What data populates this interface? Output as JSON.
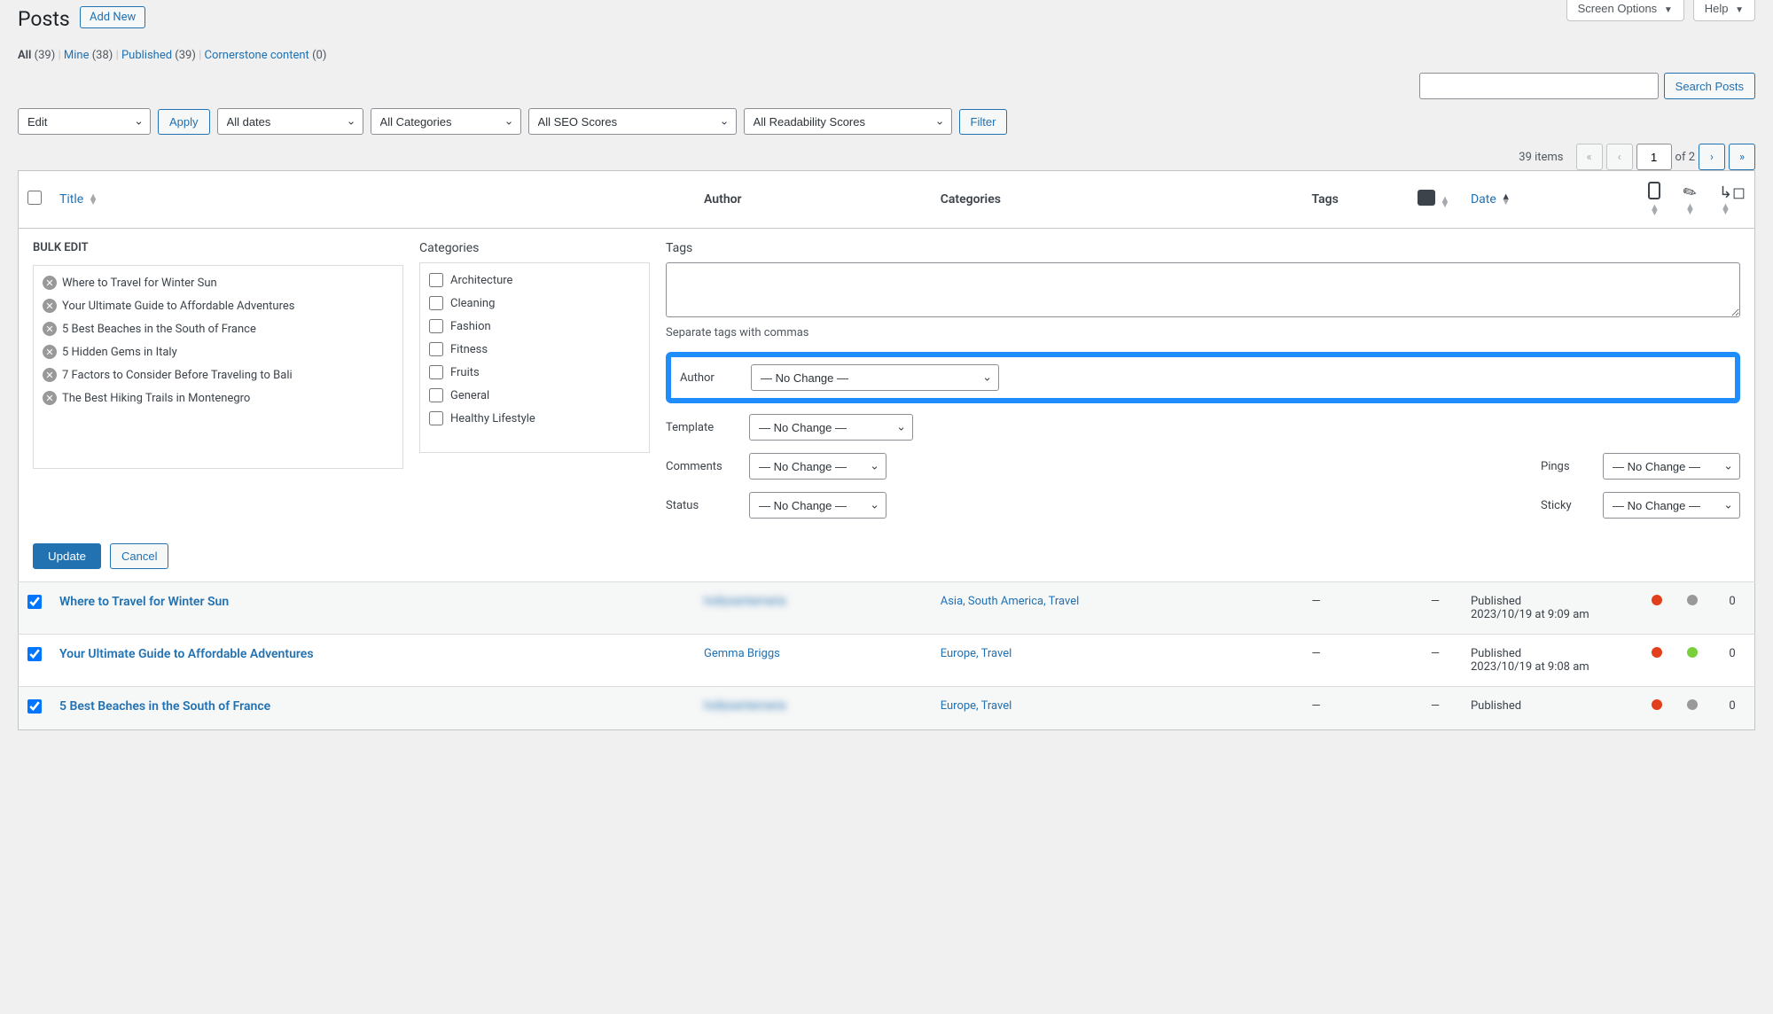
{
  "screenOptions": "Screen Options",
  "help": "Help",
  "page": {
    "title": "Posts",
    "addNew": "Add New"
  },
  "filters": {
    "all": "All",
    "allCount": "(39)",
    "mine": "Mine",
    "mineCount": "(38)",
    "published": "Published",
    "publishedCount": "(39)",
    "cornerstone": "Cornerstone content",
    "cornerstoneCount": "(0)"
  },
  "searchButton": "Search Posts",
  "bulk": {
    "action": "Edit",
    "apply": "Apply",
    "dates": "All dates",
    "categories": "All Categories",
    "seo": "All SEO Scores",
    "readability": "All Readability Scores",
    "filter": "Filter"
  },
  "pagination": {
    "items": "39 items",
    "current": "1",
    "total": "of 2"
  },
  "columns": {
    "title": "Title",
    "author": "Author",
    "categories": "Categories",
    "tags": "Tags",
    "date": "Date"
  },
  "bulkEdit": {
    "heading": "BULK EDIT",
    "categoriesLabel": "Categories",
    "tagsLabel": "Tags",
    "posts": [
      "Where to Travel for Winter Sun",
      "Your Ultimate Guide to Affordable Adventures",
      "5 Best Beaches in the South of France",
      "5 Hidden Gems in Italy",
      "7 Factors to Consider Before Traveling to Bali",
      "The Best Hiking Trails in Montenegro"
    ],
    "categories": [
      "Architecture",
      "Cleaning",
      "Fashion",
      "Fitness",
      "Fruits",
      "General",
      "Healthy Lifestyle"
    ],
    "tagsHelper": "Separate tags with commas",
    "authorLabel": "Author",
    "templateLabel": "Template",
    "commentsLabel": "Comments",
    "statusLabel": "Status",
    "pingsLabel": "Pings",
    "stickyLabel": "Sticky",
    "noChange": "— No Change —",
    "update": "Update",
    "cancel": "Cancel"
  },
  "rows": [
    {
      "title": "Where to Travel for Winter Sun",
      "author": "hollysantamaria",
      "blurred": true,
      "cats": "Asia, South America, Travel",
      "tags": "—",
      "comments": "—",
      "status": "Published",
      "date": "2023/10/19 at 9:09 am",
      "seo": "red",
      "read": "gray",
      "links": "0"
    },
    {
      "title": "Your Ultimate Guide to Affordable Adventures",
      "author": "Gemma Briggs",
      "blurred": false,
      "cats": "Europe, Travel",
      "tags": "—",
      "comments": "—",
      "status": "Published",
      "date": "2023/10/19 at 9:08 am",
      "seo": "red",
      "read": "green",
      "links": "0"
    },
    {
      "title": "5 Best Beaches in the South of France",
      "author": "hollysantamaria",
      "blurred": true,
      "cats": "Europe, Travel",
      "tags": "—",
      "comments": "—",
      "status": "Published",
      "date": "",
      "seo": "red",
      "read": "gray",
      "links": "0"
    }
  ]
}
